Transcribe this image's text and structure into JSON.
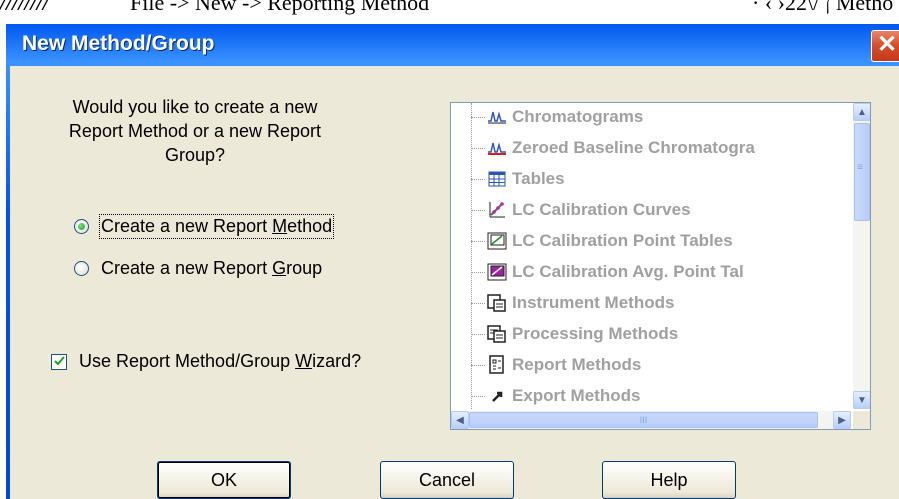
{
  "context_strip": {
    "left": "////////",
    "main": "File -> New -> Reporting  Method",
    "right": "· ‹ ›ן /\\22 Metho"
  },
  "window": {
    "title": "New Method/Group",
    "close_glyph": "✕"
  },
  "question": "Would you like to create a new Report Method or a new Report Group?",
  "radios": [
    {
      "pre": "Create a new Report ",
      "accel": "M",
      "post": "ethod",
      "checked": true
    },
    {
      "pre": "Create a new Report ",
      "accel": "G",
      "post": "roup",
      "checked": false
    }
  ],
  "wizard_checkbox": {
    "pre": "Use Report Method/Group ",
    "accel": "W",
    "post": "izard?",
    "checked": true
  },
  "tree_items": [
    {
      "label": "Chromatograms",
      "icon": "chromatogram-icon"
    },
    {
      "label": "Zeroed Baseline Chromatogra",
      "icon": "zeroed-baseline-chromatogram-icon"
    },
    {
      "label": "Tables",
      "icon": "table-icon"
    },
    {
      "label": "LC Calibration Curves",
      "icon": "calibration-curve-icon"
    },
    {
      "label": "LC Calibration Point Tables",
      "icon": "calibration-point-table-icon"
    },
    {
      "label": "LC Calibration Avg. Point Tal",
      "icon": "calibration-avg-point-table-icon"
    },
    {
      "label": "Instrument Methods",
      "icon": "instrument-method-icon"
    },
    {
      "label": "Processing Methods",
      "icon": "processing-method-icon"
    },
    {
      "label": "Report Methods",
      "icon": "report-method-icon"
    },
    {
      "label": "Export Methods",
      "icon": "export-method-icon"
    }
  ],
  "buttons": {
    "ok": "OK",
    "cancel": "Cancel",
    "help": "Help"
  },
  "scroll_glyphs": {
    "up": "▲",
    "down": "▼",
    "left": "◀",
    "right": "▶",
    "grip_h": "III",
    "grip_v": "≡"
  },
  "colors": {
    "title_bar": "#0055e5",
    "dialog_face": "#ece9d8",
    "close": "#d34d2a",
    "disabled_text": "#a0a0a0"
  }
}
